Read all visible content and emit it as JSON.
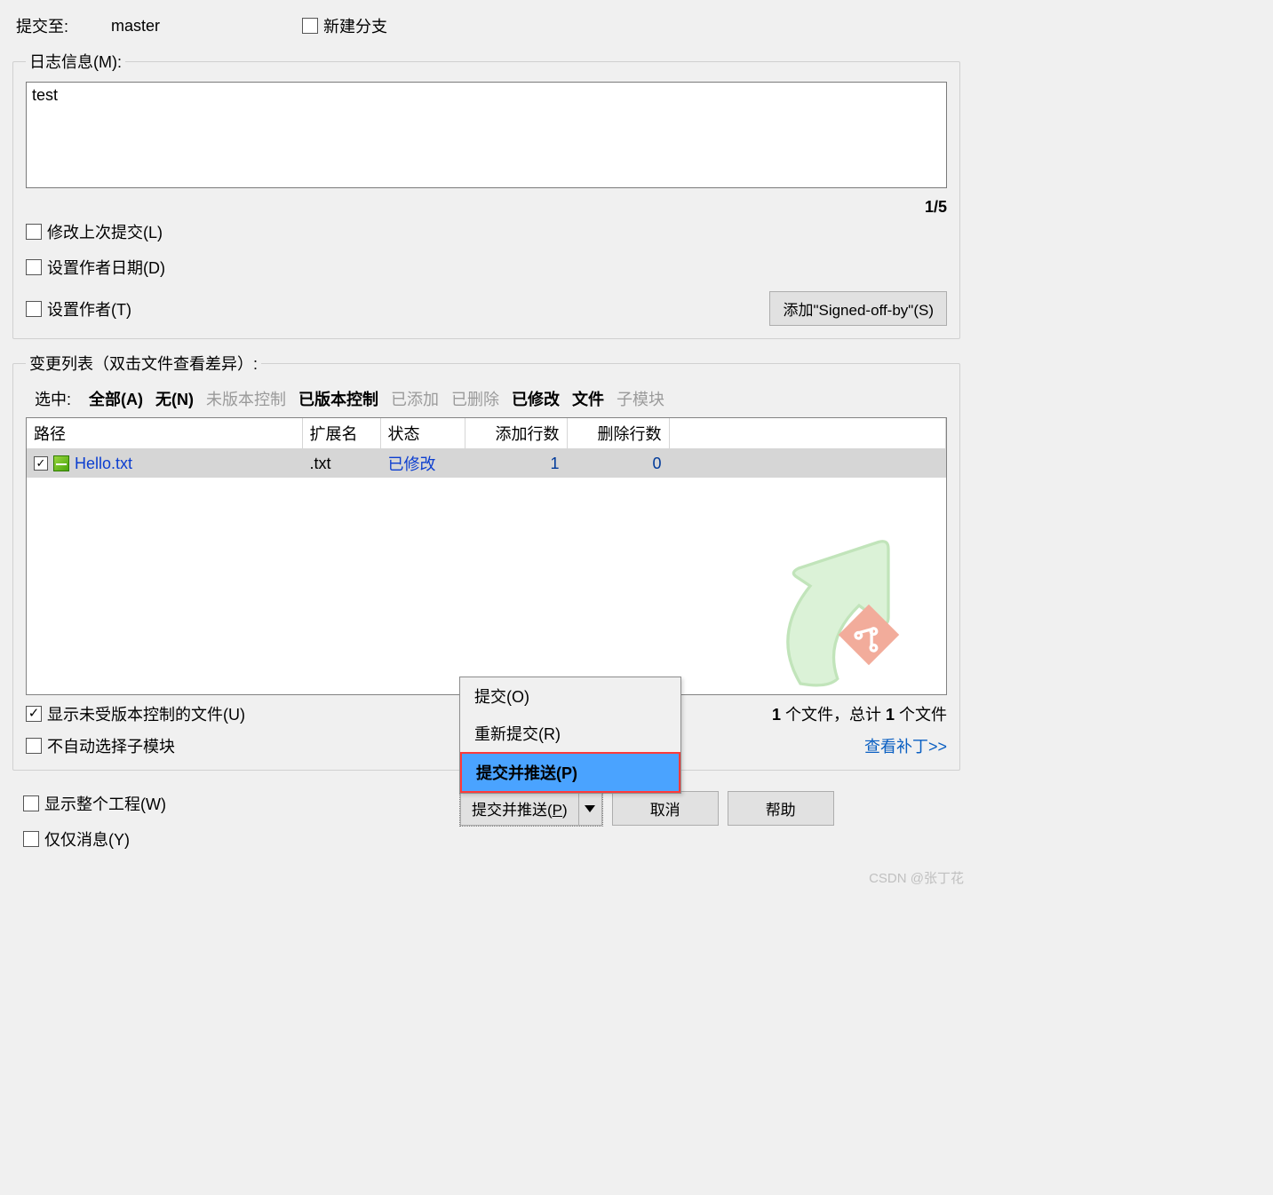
{
  "top": {
    "commit_to_label": "提交至:",
    "branch": "master",
    "new_branch_label": "新建分支"
  },
  "log": {
    "legend": "日志信息(M):",
    "message": "test",
    "counter": "1/5",
    "amend_label": "修改上次提交(L)",
    "author_date_label": "设置作者日期(D)",
    "set_author_label": "设置作者(T)",
    "signed_off_btn": "添加\"Signed-off-by\"(S)"
  },
  "changes": {
    "legend": "变更列表（双击文件查看差异）:",
    "select_label": "选中:",
    "filters": {
      "all": "全部(A)",
      "none": "无(N)",
      "unversioned": "未版本控制",
      "versioned": "已版本控制",
      "added": "已添加",
      "deleted": "已删除",
      "modified": "已修改",
      "files": "文件",
      "submodules": "子模块"
    },
    "columns": {
      "path": "路径",
      "ext": "扩展名",
      "status": "状态",
      "added": "添加行数",
      "deleted": "删除行数"
    },
    "rows": [
      {
        "checked": true,
        "name": "Hello.txt",
        "ext": ".txt",
        "status": "已修改",
        "added": "1",
        "deleted": "0"
      }
    ],
    "show_unversioned_label": "显示未受版本控制的文件(U)",
    "no_auto_submodule_label": "不自动选择子模块",
    "summary_prefix": "",
    "summary_count1": "1",
    "summary_mid": " 个文件，总计 ",
    "summary_count2": "1",
    "summary_suffix": " 个文件",
    "view_patch": "查看补丁>>"
  },
  "bottom": {
    "show_whole_project": "显示整个工程(W)",
    "message_only": "仅仅消息(Y)"
  },
  "menu": {
    "commit": "提交(O)",
    "recommit": "重新提交(R)",
    "commit_push": "提交并推送(P)"
  },
  "actions": {
    "commit_push_btn_pre": "提交并推送(",
    "commit_push_btn_u": "P",
    "commit_push_btn_post": ")",
    "cancel": "取消",
    "help": "帮助"
  },
  "watermark": "CSDN @张丁花"
}
